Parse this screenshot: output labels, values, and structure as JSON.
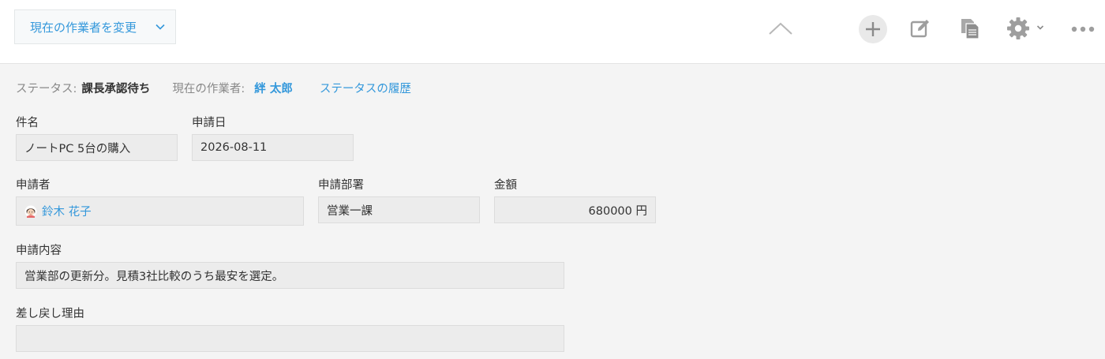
{
  "toolbar": {
    "change_assignee_label": "現在の作業者を変更",
    "icons": [
      "chevron-up-icon",
      "add-icon",
      "edit-icon",
      "duplicate-icon",
      "gear-icon",
      "more-icon"
    ]
  },
  "status": {
    "status_label": "ステータス:",
    "status_value": "課長承認待ち",
    "worker_label": "現在の作業者:",
    "worker_value": "絆 太郎",
    "history_link": "ステータスの履歴"
  },
  "fields": {
    "title": {
      "label": "件名",
      "value": "ノートPC 5台の購入"
    },
    "date": {
      "label": "申請日",
      "value": "2026-08-11"
    },
    "applicant": {
      "label": "申請者",
      "value": "鈴木 花子"
    },
    "department": {
      "label": "申請部署",
      "value": "営業一課"
    },
    "amount": {
      "label": "金額",
      "value": "680000 円"
    },
    "content": {
      "label": "申請内容",
      "value": "営業部の更新分。見積3社比較のうち最安を選定。"
    },
    "reason": {
      "label": "差し戻し理由",
      "value": ""
    }
  },
  "colors": {
    "accent": "#3498db",
    "background": "#f4f4f4",
    "field_background": "#ececec",
    "icon_gray": "#9e9e9e"
  }
}
